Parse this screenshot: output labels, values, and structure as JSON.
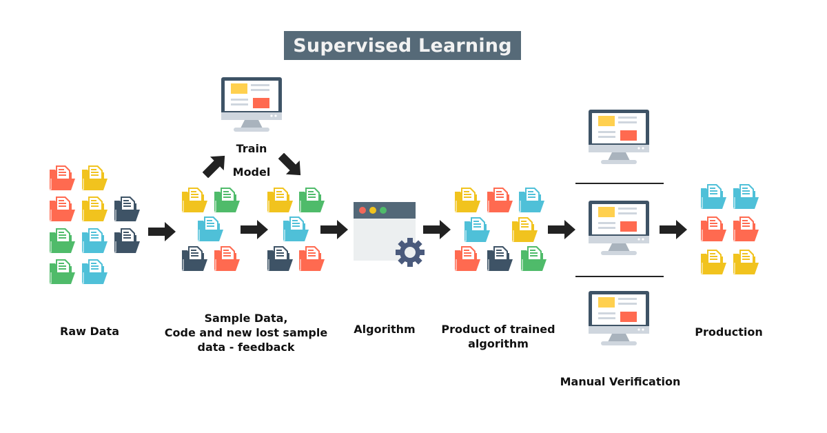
{
  "title": "Supervised Learning",
  "colors": {
    "red": "#ff6a50",
    "yellow": "#f1c31e",
    "green": "#4fbb6a",
    "blue": "#4fc0d8",
    "navy": "#3e5366",
    "title_bg": "#566a78"
  },
  "stages": {
    "raw_data": {
      "label": "Raw Data",
      "folders": [
        "red",
        "yellow",
        "red",
        "yellow",
        "navy",
        "green",
        "blue",
        "navy",
        "green",
        "blue"
      ]
    },
    "sample_data": {
      "label_lines": [
        "Sample Data,",
        "Code and new lost sample",
        "data - feedback"
      ],
      "folders": [
        "yellow",
        "green",
        "blue",
        "navy",
        "red"
      ]
    },
    "train_model": {
      "label_lines": [
        "Train",
        "Model"
      ],
      "icon": "monitor-icon"
    },
    "sample_data_feedback": {
      "folders": [
        "yellow",
        "green",
        "blue",
        "navy",
        "red"
      ]
    },
    "algorithm": {
      "label": "Algorithm",
      "icon": "browser-window-gear-icon",
      "dots": [
        "#f2685a",
        "#f1c31e",
        "#4fbb6a"
      ]
    },
    "product": {
      "label_lines": [
        "Product of trained",
        "algorithm"
      ],
      "folders": [
        "yellow",
        "red",
        "blue",
        "blue",
        "yellow",
        "red",
        "navy",
        "green"
      ]
    },
    "manual_verification": {
      "label": "Manual Verification",
      "monitors": 3
    },
    "production": {
      "label": "Production",
      "folders": [
        "blue",
        "blue",
        "red",
        "red",
        "yellow",
        "yellow"
      ]
    }
  }
}
